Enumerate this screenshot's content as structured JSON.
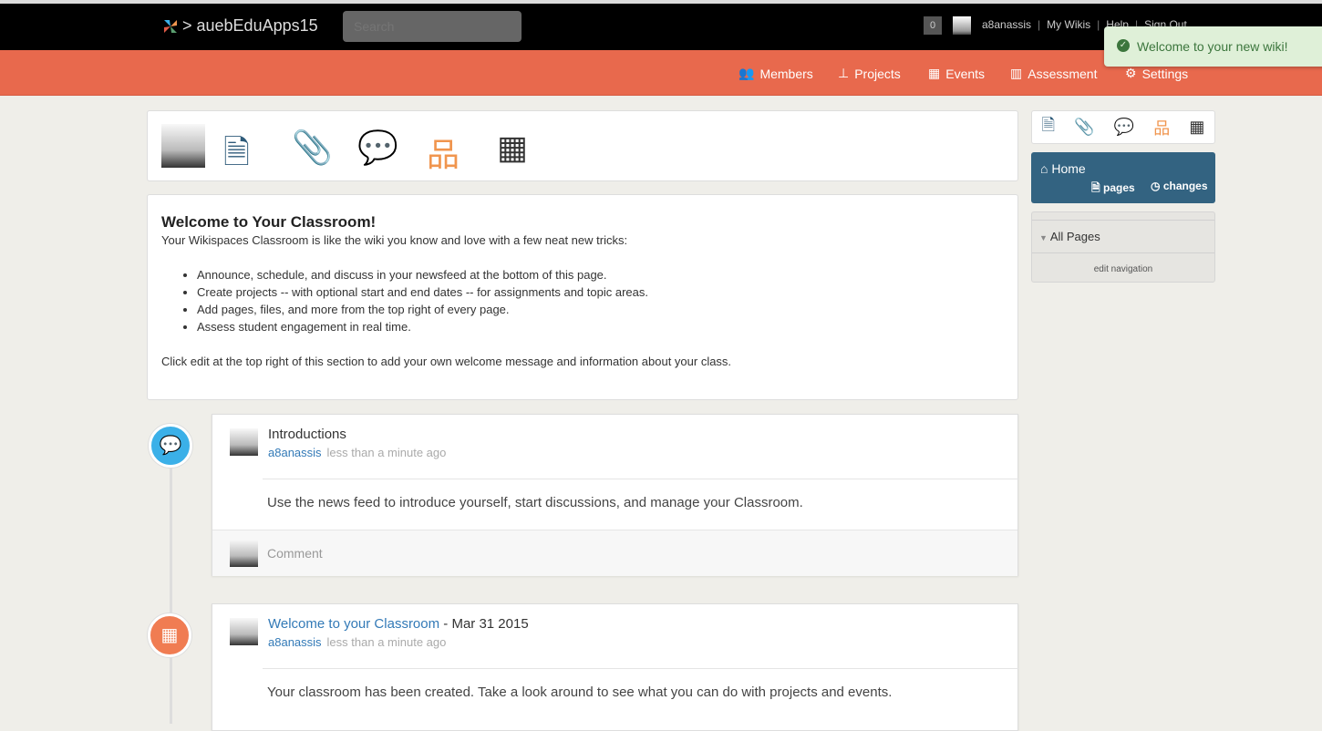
{
  "header": {
    "brand": "> auebEduApps15",
    "search_placeholder": "Search",
    "notification_count": "0",
    "username": "a8anassis",
    "links": [
      "My Wikis",
      "Help",
      "Sign Out"
    ]
  },
  "nav": [
    {
      "label": "Members",
      "icon": "users-icon"
    },
    {
      "label": "Projects",
      "icon": "sitemap-icon"
    },
    {
      "label": "Events",
      "icon": "calendar-icon"
    },
    {
      "label": "Assessment",
      "icon": "chart-icon"
    },
    {
      "label": "Settings",
      "icon": "gear-icon"
    }
  ],
  "toast": "Welcome to your new wiki!",
  "welcome": {
    "title": "Welcome to Your Classroom!",
    "intro": "Your Wikispaces Classroom is like the wiki you know and love with a few neat new tricks:",
    "bullets": [
      "Announce, schedule, and discuss in your newsfeed at the bottom of this page.",
      "Create projects -- with optional start and end dates -- for assignments and topic areas.",
      "Add pages, files, and more from the top right of every page.",
      "Assess student engagement in real time."
    ],
    "footer": "Click edit at the top right of this section to add your own welcome message and information about your class."
  },
  "feed": [
    {
      "title": "Introductions",
      "author": "a8anassis",
      "time": "less than a minute ago",
      "body": "Use the news feed to introduce yourself, start discussions, and manage your Classroom.",
      "comment_placeholder": "Comment",
      "color": "#3bb0e8"
    },
    {
      "title": "Welcome to your Classroom",
      "date": " - Mar 31 2015",
      "author": "a8anassis",
      "time": "less than a minute ago",
      "body": "Your classroom has been created. Take a look around to see what you can do with projects and events.",
      "color": "#f07c52"
    }
  ],
  "sidebar": {
    "home": "Home",
    "pages": "pages",
    "changes": "changes",
    "all_pages": "All Pages",
    "edit_nav": "edit navigation"
  },
  "colors": {
    "navbar": "#e8694d",
    "home": "#336381",
    "page": "#2f5b7a",
    "file": "#5a9e6f",
    "discuss": "#e05a46",
    "project": "#f0954e",
    "event": "#333333"
  }
}
